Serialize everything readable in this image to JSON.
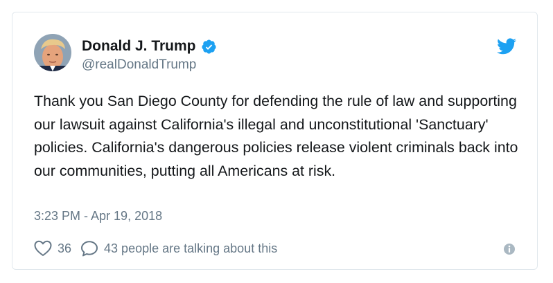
{
  "tweet": {
    "display_name": "Donald J. Trump",
    "handle": "@realDonaldTrump",
    "text": "Thank you San Diego County for defending the rule of law and supporting our lawsuit against California's illegal and unconstitutional 'Sanctuary' policies. California's dangerous policies release violent criminals back into our communities, putting all Americans at risk.",
    "timestamp": "3:23 PM - Apr 19, 2018",
    "likes": "36",
    "talking": "43 people are talking about this"
  },
  "icons": {
    "verified": "verified-badge-icon",
    "brand": "twitter-bird-icon",
    "like": "heart-icon",
    "reply": "reply-bubble-icon",
    "info": "info-icon"
  },
  "colors": {
    "brand_blue": "#1da1f2",
    "text_primary": "#14171a",
    "text_secondary": "#657786",
    "border": "#e1e8ed",
    "info_gray": "#aab8c2"
  }
}
